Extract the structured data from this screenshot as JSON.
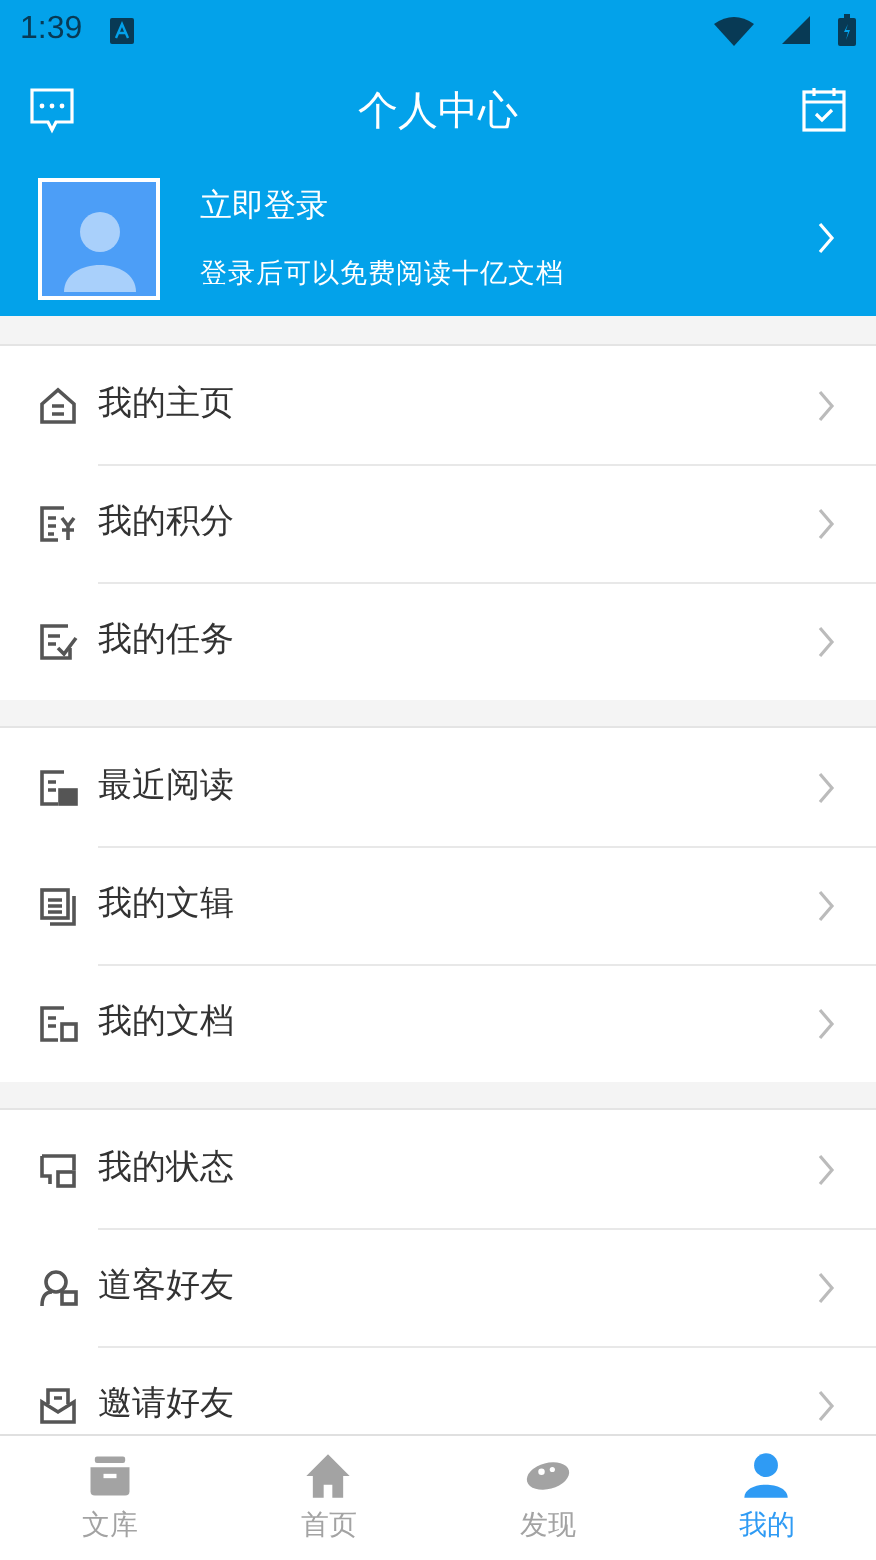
{
  "status_bar": {
    "time": "1:39"
  },
  "header": {
    "title": "个人中心"
  },
  "profile": {
    "name": "立即登录",
    "subtitle": "登录后可以免费阅读十亿文档"
  },
  "sections": [
    {
      "items": [
        {
          "label": "我的主页"
        },
        {
          "label": "我的积分"
        },
        {
          "label": "我的任务"
        }
      ]
    },
    {
      "items": [
        {
          "label": "最近阅读"
        },
        {
          "label": "我的文辑"
        },
        {
          "label": "我的文档"
        }
      ]
    },
    {
      "items": [
        {
          "label": "我的状态"
        },
        {
          "label": "道客好友"
        },
        {
          "label": "邀请好友"
        }
      ]
    }
  ],
  "tab_bar": [
    {
      "label": "文库",
      "selected": false
    },
    {
      "label": "首页",
      "selected": false
    },
    {
      "label": "发现",
      "selected": false
    },
    {
      "label": "我的",
      "selected": true
    }
  ]
}
